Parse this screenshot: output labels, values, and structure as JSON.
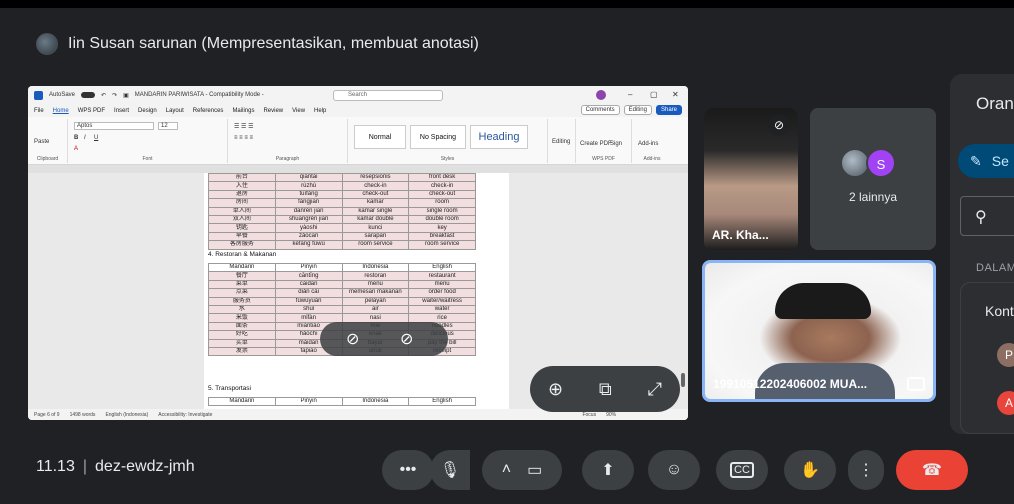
{
  "presenter": {
    "text": "Iin Susan sarunan (Mempresentasikan, membuat anotasi)"
  },
  "word": {
    "autosave": "AutoSave",
    "doc_title": "MANDARIN PARIWISATA  -  Compatibility Mode  -",
    "search_placeholder": "Search",
    "menu": [
      "File",
      "Home",
      "WPS PDF",
      "Insert",
      "Design",
      "Layout",
      "References",
      "Mailings",
      "Review",
      "View",
      "Help"
    ],
    "comments": "Comments",
    "editing": "Editing",
    "share": "Share",
    "font_name": "Aptos",
    "font_size": "12",
    "groups": {
      "clipboard": "Clipboard",
      "font": "Font",
      "paragraph": "Paragraph",
      "styles": "Styles",
      "editing": "Editing",
      "wps_pdf": "WPS PDF",
      "addins": "Add-ins"
    },
    "paste": "Paste",
    "styles": [
      "Normal",
      "No Spacing",
      "Heading"
    ],
    "create_pdf": "Create PDF",
    "sign": "Sign",
    "addins_btn": "Add-ins",
    "status": [
      "Page 6 of 9",
      "1498 words",
      "English (Indonesia)",
      "Accessibility: Investigate",
      "Focus"
    ],
    "zoom_pct": "90%"
  },
  "doc": {
    "table1": [
      [
        "前台",
        "qiántái",
        "resepsionis",
        "front desk"
      ],
      [
        "入住",
        "rùzhù",
        "check-in",
        "check-in"
      ],
      [
        "退房",
        "tuìfáng",
        "check-out",
        "check-out"
      ],
      [
        "房间",
        "fángjiān",
        "kamar",
        "room"
      ],
      [
        "单人间",
        "dānrén jiān",
        "kamar single",
        "single room"
      ],
      [
        "双人间",
        "shuāngrén jiān",
        "kamar double",
        "double room"
      ],
      [
        "钥匙",
        "yàoshi",
        "kunci",
        "key"
      ],
      [
        "早餐",
        "zǎocān",
        "sarapan",
        "breakfast"
      ],
      [
        "客房服务",
        "kèfáng fúwù",
        "room service",
        "room service"
      ]
    ],
    "section4": "4. Restoran & Makanan",
    "table2_head": [
      "Mandarin",
      "Pinyin",
      "Indonesia",
      "English"
    ],
    "table2": [
      [
        "餐厅",
        "cāntīng",
        "restoran",
        "restaurant"
      ],
      [
        "菜单",
        "càidān",
        "menu",
        "menu"
      ],
      [
        "点菜",
        "diǎn cài",
        "memesan makanan",
        "order food"
      ],
      [
        "服务员",
        "fúwùyuán",
        "pelayan",
        "waiter/waitress"
      ],
      [
        "水",
        "shuǐ",
        "air",
        "water"
      ],
      [
        "米饭",
        "mǐfàn",
        "nasi",
        "rice"
      ],
      [
        "面条",
        "miàntiáo",
        "mie",
        "noodles"
      ],
      [
        "好吃",
        "hǎochī",
        "enak",
        "delicious"
      ],
      [
        "买单",
        "mǎidān",
        "bayar",
        "pay the bill"
      ],
      [
        "发票",
        "fāpiào",
        "struk",
        "receipt"
      ]
    ],
    "section5": "5. Transportasi",
    "table3_head": [
      "Mandarin",
      "Pinyin",
      "Indonesia",
      "English"
    ]
  },
  "tiles": {
    "participant1": "AR. Kha...",
    "others_label": "2 lainnya",
    "others_initial": "S",
    "participant2": "199105122024060​02 MUA..."
  },
  "side": {
    "title": "Oran",
    "button": "Se",
    "section": "DALAM",
    "card_title": "Kont",
    "avatars": [
      "P",
      "A"
    ],
    "avatar_colors": [
      "#8d6e63",
      "#e8453c"
    ]
  },
  "meeting": {
    "time": "11.13",
    "code": "dez-ewdz-jmh"
  },
  "controls": {
    "more_icon": "more-vert-icon",
    "end_color": "#ea4335",
    "accent": "#8ab4f8"
  }
}
